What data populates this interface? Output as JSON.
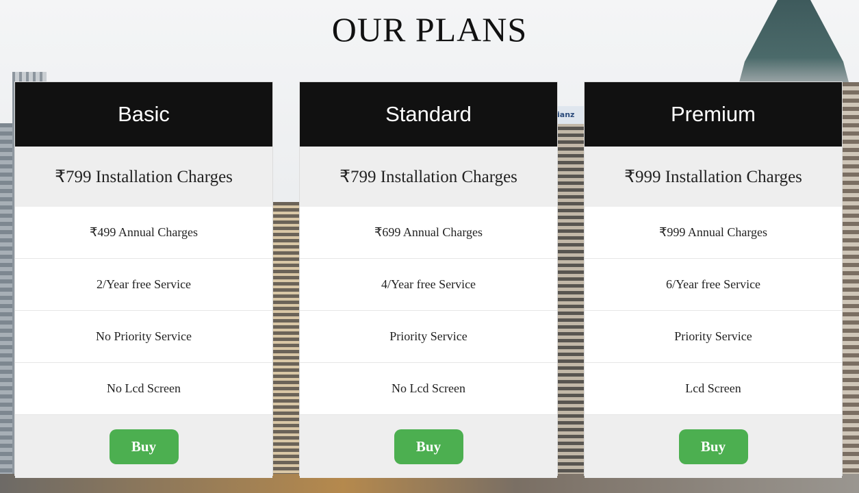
{
  "page": {
    "title": "OUR PLANS"
  },
  "background": {
    "sign_text": "ianz"
  },
  "plans": [
    {
      "name": "Basic",
      "installation": "₹799 Installation Charges",
      "features": [
        "₹499 Annual Charges",
        "2/Year free Service",
        "No Priority Service",
        "No Lcd Screen"
      ],
      "button": "Buy"
    },
    {
      "name": "Standard",
      "installation": "₹799 Installation Charges",
      "features": [
        "₹699 Annual Charges",
        "4/Year free Service",
        "Priority Service",
        "No Lcd Screen"
      ],
      "button": "Buy"
    },
    {
      "name": "Premium",
      "installation": "₹999 Installation Charges",
      "features": [
        "₹999 Annual Charges",
        "6/Year free Service",
        "Priority Service",
        "Lcd Screen"
      ],
      "button": "Buy"
    }
  ],
  "colors": {
    "header_bg": "#111111",
    "button_bg": "#4caf50",
    "row_alt_bg": "#eeeeee"
  }
}
